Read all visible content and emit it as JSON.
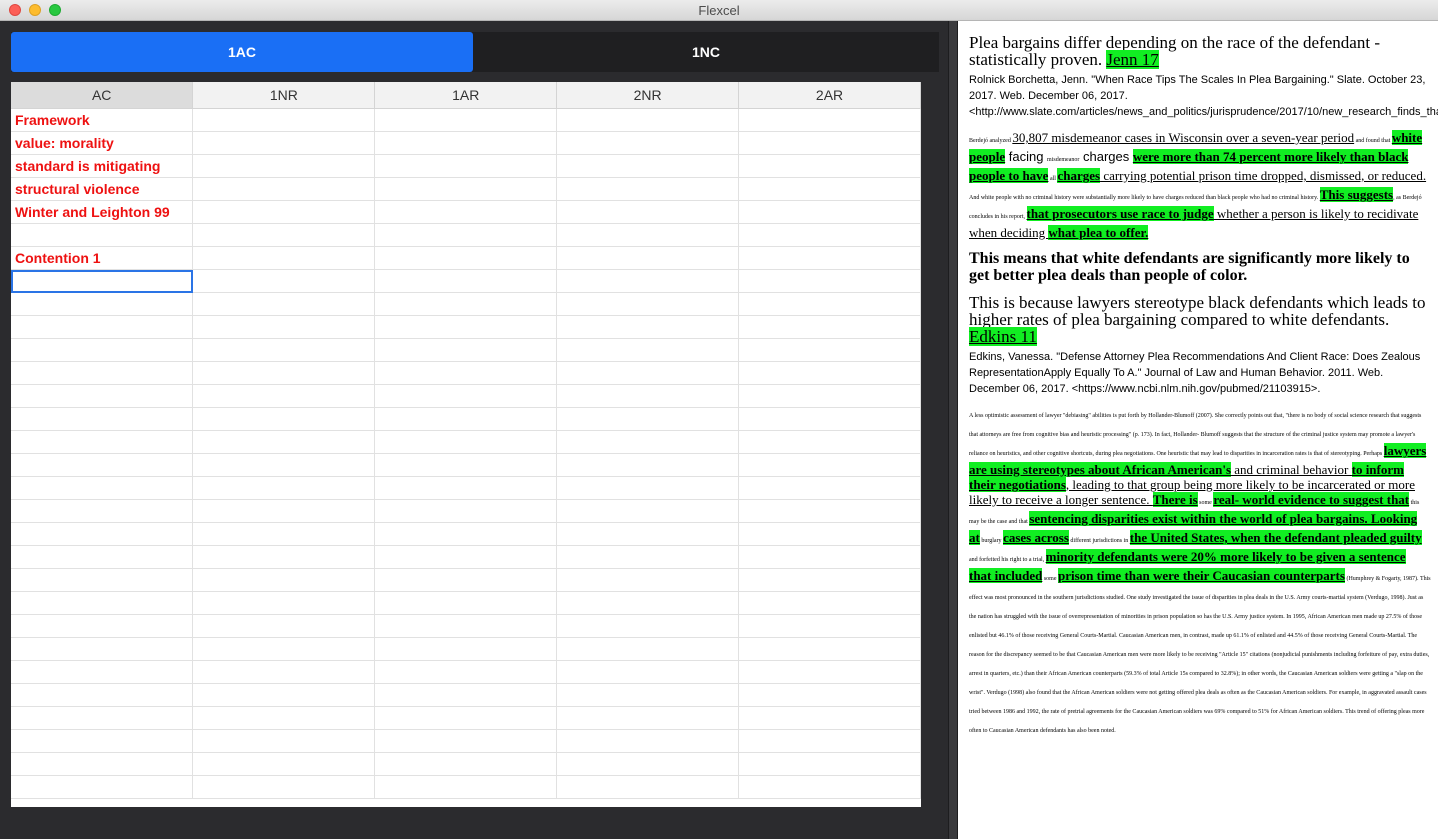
{
  "window": {
    "title": "Flexcel"
  },
  "tabs": [
    {
      "label": "1AC"
    },
    {
      "label": "1NC"
    }
  ],
  "sheet": {
    "columns": [
      "AC",
      "1NR",
      "1AR",
      "2NR",
      "2AR"
    ],
    "ac_cells": [
      "Framework",
      "value: morality",
      "standard is mitigating",
      "structural violence",
      "Winter and Leighton 99",
      "",
      "Contention 1"
    ]
  },
  "doc": {
    "tag1_text": "Plea bargains differ depending on the race of the defendant - statistically proven. ",
    "tag1_author": "Jenn 17",
    "cite1": "Rolnick Borchetta, Jenn. \"When Race Tips The Scales In Plea Bargaining.\" Slate. October 23, 2017. Web. December 06, 2017. <http://www.slate.com/articles/news_and_politics/jurisprudence/2017/10/new_research_finds_that_prosecutors_give_white_defendants_better_deals_than.html>.",
    "card1": {
      "p1": "Berdejó analyzed ",
      "p2": "30,807 misdemeanor cases in Wisconsin over a seven-year period",
      "p3": " and found that ",
      "p4": "white people",
      "p5": " facing ",
      "p6": "misdemeanor",
      "p7": " charges ",
      "p8": "were more than 74 percent more likely than black people to have",
      "p9": " all ",
      "p10": "charges",
      "p11": " carrying potential prison time dropped, dismissed, or reduced.",
      "p12": " And white people with no criminal history were substantially more likely to have charges reduced than black people who had no criminal history. ",
      "p13": "This suggests",
      "p14": ", as Berdejó concludes in his report, ",
      "p15": "that prosecutors use race to judge",
      "p16": " whether a person is likely to recidivate when deciding ",
      "p17": "what plea to offer."
    },
    "tag2": "This means that white defendants are significantly more likely to get better plea deals than people of color.",
    "tag3_text": "This is because lawyers stereotype black defendants which leads to higher rates of plea bargaining compared to white defendants. ",
    "tag3_author": "Edkins 11",
    "cite2": "Edkins, Vanessa. \"Defense Attorney Plea Recommendations And Client Race: Does Zealous RepresentationApply Equally To A.\" Journal of Law and Human Behavior. 2011. Web. December 06, 2017. <https://www.ncbi.nlm.nih.gov/pubmed/21103915>.",
    "card2": {
      "p1": "A less optimistic assessment of lawyer \"debiasing\" abilities is put forth by Hollander-Blumoff (2007). She correctly points out that, \"there is no body of social science research that suggests that attorneys are free from cognitive bias and heuristic processing\" (p. 173). In fact, Hollander- Blumoff suggests that the structure of the criminal justice system may promote a lawyer's reliance on heuristics, and other cognitive shortcuts, during plea negotiations. One heuristic that may lead to disparities in incarceration rates is that of stereotyping. Perhaps ",
      "p2": "lawyers are using stereotypes about African American's",
      "p3": " and criminal behavior ",
      "p4": "to inform their negotiations",
      "p5": ", leading to that group being more likely to be incarcerated or more likely to receive a longer sentence. ",
      "p6": "There is",
      "p7": " some ",
      "p8": "real- world evidence to suggest that",
      "p9": " this may be the case and that ",
      "p10": "sentencing disparities exist within the world of plea bargains. Looking at",
      "p11": " burglary ",
      "p12": "cases across",
      "p13": " different jurisdictions in ",
      "p14": "the United States, when the defendant pleaded guilty",
      "p15": " and forfeited his right to a trial, ",
      "p16": "minority defendants were 20% more likely to be given a sentence that included",
      "p17": " some ",
      "p18": "prison time than were their Caucasian counterparts",
      "p19": " (Humphrey & Fogarty, 1987). This effect was most pronounced in the southern jurisdictions studied. One study investigated the issue of disparities in plea deals in the U.S. Army courts-martial system (Verdugo, 1998). Just as the nation has struggled with the issue of overrepresentation of minorities in prison population so has the U.S. Army justice system. In 1995, African American men made up 27.5% of those enlisted but 46.1% of those receiving General Courts-Martial. Caucasian American men, in contrast, made up 61.1% of enlisted and 44.5% of those receiving General Courts-Martial. The reason for the discrepancy seemed to be that Caucasian American men were more likely to be receiving \"Article 15\" citations (nonjudicial punishments including forfeiture of pay, extra duties, arrest in quarters, etc.) than their African American counterparts (59.3% of total Article 15s compared to 32.8%); in other words, the Caucasian American soldiers were getting a \"slap on the wrist\". Verdugo (1998) also found that the African American soldiers were not getting offered plea deals as often as the Caucasian American soldiers. For example, in aggravated assault cases tried between 1986 and 1992, the rate of pretrial agreements for the Caucasian American soldiers was 69% compared to 51% for African American soldiers. This trend of offering pleas more often to Caucasian American defendants has also been noted."
    }
  }
}
